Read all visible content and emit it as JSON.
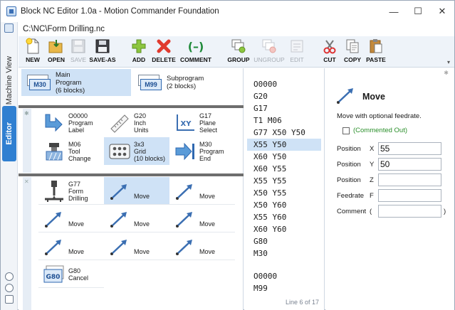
{
  "window": {
    "title": "Block NC Editor 1.0a - Motion Commander Foundation",
    "controls": {
      "minimize": "—",
      "maximize": "☐",
      "close": "✕"
    }
  },
  "left_rail": {
    "tabs": [
      {
        "label": "Machine View"
      },
      {
        "label": "Editor"
      }
    ]
  },
  "path": "C:\\NC\\Form Drilling.nc",
  "toolbar": {
    "buttons": [
      {
        "label": "NEW",
        "icon": "new-file-icon",
        "enabled": true
      },
      {
        "label": "OPEN",
        "icon": "open-folder-icon",
        "enabled": true
      },
      {
        "label": "SAVE",
        "icon": "save-disk-icon",
        "enabled": false
      },
      {
        "label": "SAVE-AS",
        "icon": "save-as-icon",
        "enabled": true
      },
      {
        "label": "ADD",
        "icon": "plus-icon",
        "enabled": true
      },
      {
        "label": "DELETE",
        "icon": "delete-x-icon",
        "enabled": true
      },
      {
        "label": "COMMENT",
        "icon": "comment-parens-icon",
        "enabled": true
      },
      {
        "label": "GROUP",
        "icon": "group-icon",
        "enabled": true
      },
      {
        "label": "UNGROUP",
        "icon": "ungroup-icon",
        "enabled": false
      },
      {
        "label": "EDIT",
        "icon": "edit-icon",
        "enabled": false
      },
      {
        "label": "CUT",
        "icon": "scissors-icon",
        "enabled": true
      },
      {
        "label": "COPY",
        "icon": "copy-icon",
        "enabled": true
      },
      {
        "label": "PASTE",
        "icon": "paste-icon",
        "enabled": true
      }
    ]
  },
  "programs": [
    {
      "code": "M30",
      "line1": "Main",
      "line2": "Program",
      "line3": "(6 blocks)",
      "selected": true
    },
    {
      "code": "M99",
      "line1": "Subprogram",
      "line2": "(2 blocks)",
      "line3": "",
      "selected": false
    }
  ],
  "library_tiles": [
    {
      "line1": "O0000",
      "line2": "Program",
      "line3": "Label",
      "icon": "program-label-arrow-icon",
      "selected": false
    },
    {
      "line1": "G20",
      "line2": "Inch",
      "line3": "Units",
      "icon": "ruler-icon",
      "selected": false
    },
    {
      "line1": "G17",
      "line2": "Plane",
      "line3": "Select",
      "icon": "xy-plane-icon",
      "selected": false
    },
    {
      "line1": "M06",
      "line2": "Tool",
      "line3": "Change",
      "icon": "tool-change-icon",
      "selected": false
    },
    {
      "line1": "3x3",
      "line2": "Grid",
      "line3": "(10 blocks)",
      "icon": "grid-icon",
      "selected": true
    },
    {
      "line1": "M30",
      "line2": "Program",
      "line3": "End",
      "icon": "program-end-icon",
      "selected": false
    }
  ],
  "program_tiles": [
    {
      "line1": "G77",
      "line2": "Form",
      "line3": "Drilling",
      "icon": "drill-icon",
      "selected": false
    },
    {
      "line1": "Move",
      "line2": "",
      "line3": "",
      "icon": "move-arrow-icon",
      "selected": true
    },
    {
      "line1": "Move",
      "line2": "",
      "line3": "",
      "icon": "move-arrow-icon",
      "selected": false
    },
    {
      "line1": "Move",
      "line2": "",
      "line3": "",
      "icon": "move-arrow-icon",
      "selected": false
    },
    {
      "line1": "Move",
      "line2": "",
      "line3": "",
      "icon": "move-arrow-icon",
      "selected": false
    },
    {
      "line1": "Move",
      "line2": "",
      "line3": "",
      "icon": "move-arrow-icon",
      "selected": false
    },
    {
      "line1": "Move",
      "line2": "",
      "line3": "",
      "icon": "move-arrow-icon",
      "selected": false
    },
    {
      "line1": "Move",
      "line2": "",
      "line3": "",
      "icon": "move-arrow-icon",
      "selected": false
    },
    {
      "line1": "Move",
      "line2": "",
      "line3": "",
      "icon": "move-arrow-icon",
      "selected": false
    },
    {
      "line1": "G80",
      "line2": "Cancel",
      "line3": "",
      "icon": "g80-icon",
      "selected": false
    }
  ],
  "code": {
    "lines": [
      "O0000",
      "G20",
      "G17",
      "T1 M06",
      "G77 X50 Y50",
      "X55 Y50",
      "X60 Y50",
      "X60 Y55",
      "X55 Y55",
      "X50 Y55",
      "X50 Y60",
      "X55 Y60",
      "X60 Y60",
      "G80",
      "M30",
      "",
      "O0000",
      "M99"
    ],
    "selected_index": 5,
    "status": "Line 6 of 17"
  },
  "properties": {
    "title": "Move",
    "description": "Move with optional feedrate.",
    "commented_out_label": "(Commented Out)",
    "commented_out": false,
    "rows": [
      {
        "name": "Position",
        "axis": "X",
        "value": "55",
        "suffix": ""
      },
      {
        "name": "Position",
        "axis": "Y",
        "value": "50",
        "suffix": ""
      },
      {
        "name": "Position",
        "axis": "Z",
        "value": "",
        "suffix": ""
      },
      {
        "name": "Feedrate",
        "axis": "F",
        "value": "",
        "suffix": ""
      },
      {
        "name": "Comment",
        "axis": "(",
        "value": "",
        "suffix": ")"
      }
    ]
  },
  "colors": {
    "selection": "#cfe2f6",
    "accent": "#2f7fd1",
    "commented_green": "#2a8f2a"
  }
}
